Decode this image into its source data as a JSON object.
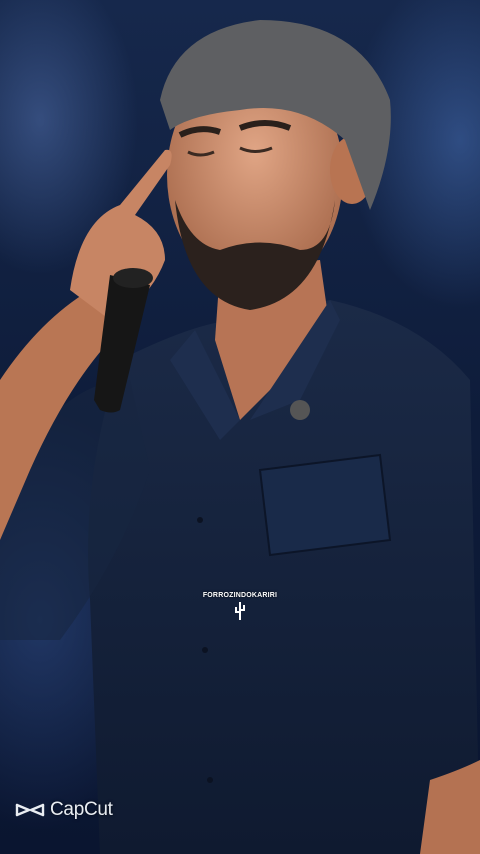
{
  "photo": {
    "subject": "bearded-singer-with-microphone",
    "colors": {
      "background": "#16284c",
      "shirt": "#14213a",
      "skin": "#c98b6a",
      "hair": "#6b6b6b"
    }
  },
  "watermark": {
    "text": "FORROZINDOKARIRI",
    "logo_icon": "cactus-icon"
  },
  "brand": {
    "name": "CapCut",
    "icon": "capcut-logo-icon"
  }
}
